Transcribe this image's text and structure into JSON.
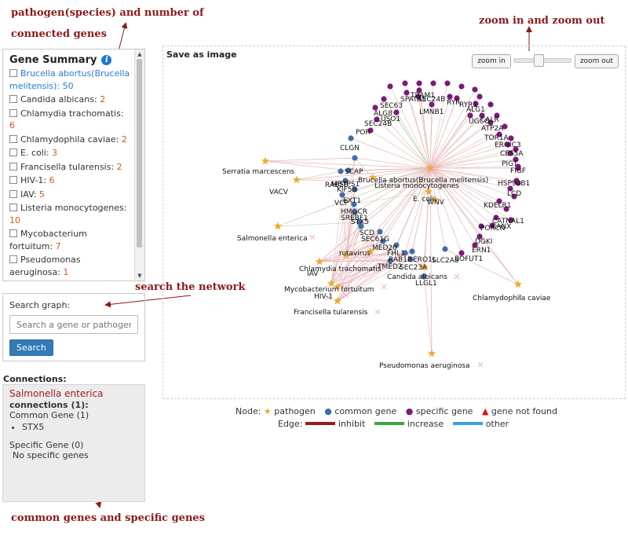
{
  "annotations": {
    "pathogen_note_line1": "pathogen(species) and number of",
    "pathogen_note_line2": "connected genes",
    "zoom_note": "zoom in and zoom out",
    "search_note": "search the network",
    "genes_note": "common genes and specific genes"
  },
  "summary": {
    "title": "Gene Summary",
    "info_icon": "i",
    "items": [
      {
        "name": "Brucella abortus(Brucella melitensis):",
        "count": "50",
        "highlight": true
      },
      {
        "name": "Candida albicans:",
        "count": "2"
      },
      {
        "name": "Chlamydia trachomatis:",
        "count": "6"
      },
      {
        "name": "Chlamydophila caviae:",
        "count": "2"
      },
      {
        "name": "E. coli:",
        "count": "3"
      },
      {
        "name": "Francisella tularensis:",
        "count": "2"
      },
      {
        "name": "HIV-1:",
        "count": "6"
      },
      {
        "name": "IAV:",
        "count": "5"
      },
      {
        "name": "Listeria monocytogenes:",
        "count": "10"
      },
      {
        "name": "Mycobacterium fortuitum:",
        "count": "7"
      },
      {
        "name": "Pseudomonas aeruginosa:",
        "count": "1"
      },
      {
        "name": "Salmonella enterica:",
        "count": "1"
      },
      {
        "name": "Serratia marcescens:",
        "count": "2"
      },
      {
        "name": "VACV:",
        "count": "2"
      }
    ]
  },
  "search": {
    "label": "Search graph:",
    "placeholder": "Search a gene or pathogen",
    "button": "Search"
  },
  "connections": {
    "label": "Connections:",
    "title": "Salmonella enterica",
    "sub": "connections (1):",
    "common_header": "Common Gene (1)",
    "common_genes": [
      "STX5"
    ],
    "specific_header": "Specific Gene (0)",
    "specific_text": "No specific genes"
  },
  "graph": {
    "save_label": "Save as image",
    "zoom_in": "zoom in",
    "zoom_out": "zoom out",
    "zoom_level": 0.45,
    "colors": {
      "pathogen": "#f0a830",
      "common": "#3e6fa8",
      "specific": "#7a1a7a",
      "inhibit": "#9b1b1b",
      "increase": "#3aa83a",
      "other": "#3aa0e8",
      "not_found": "#d11",
      "edge_light": "#e7b8b8",
      "edge_green": "#b8dcb0"
    },
    "pathogens": [
      "Serratia marcescens",
      "VACV",
      "Brucella abortus(Brucella melitensis)",
      "Listeria monocytogenes",
      "E. coli",
      "WNV",
      "Salmonella enterica",
      "Chlamydia trachomatis",
      "IAV",
      "rotavirus",
      "Mycobacterium fortuitum",
      "HIV-1",
      "Francisella tularensis",
      "Candida albicans",
      "Chlamydophila caviae",
      "Pseudomonas aeruginosa"
    ],
    "common_genes": [
      "CLGN",
      "SCAP",
      "MBTPS1",
      "RAB5B",
      "KIF5B",
      "EXT1",
      "VCP",
      "HMGCR",
      "SREBF1",
      "STX5",
      "SCD",
      "SEC61G",
      "MED20",
      "FHL1",
      "RAB1B",
      "ERO1L",
      "TMED2",
      "SEC23A",
      "SLC2A8",
      "LLGL1"
    ],
    "specific_genes": [
      "ALG8",
      "SEC63",
      "USO1",
      "SEC24B",
      "POR",
      "LMNB1",
      "TRAM1",
      "SPATA5",
      "SEC24B",
      "RYR2",
      "RYR1",
      "ALG12",
      "UGCG",
      "CALR",
      "ATP2A2",
      "TOR1A",
      "ERGIC3",
      "CES5A",
      "PIGT",
      "FIGF",
      "HSP90B1",
      "LCD",
      "KDELR1",
      "CATNAL1",
      "CANX",
      "PORCN",
      "DGKI",
      "ERN1",
      "BOFUT1"
    ],
    "not_found": [
      "Serratia marcescens",
      "VACV",
      "Salmonella enterica",
      "Mycobacterium fortuitum",
      "HIV-1",
      "Francisella tularensis",
      "Candida albicans",
      "Chlamydophila caviae",
      "Pseudomonas aeruginosa",
      "IAV",
      "rotavirus",
      "Chlamydia trachomatis"
    ]
  },
  "legend": {
    "node_label": "Node:",
    "pathogen": "pathogen",
    "common_gene": "common gene",
    "specific_gene": "specific gene",
    "not_found": "gene not found",
    "edge_label": "Edge:",
    "inhibit": "inhibit",
    "increase": "increase",
    "other": "other"
  }
}
